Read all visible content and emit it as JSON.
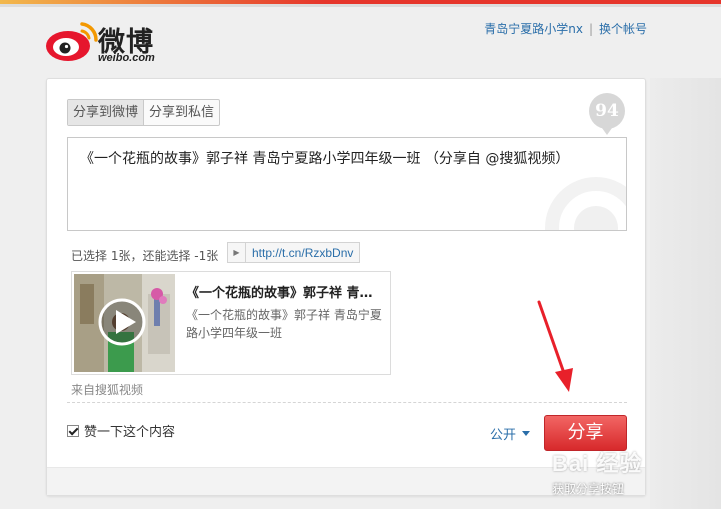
{
  "header": {
    "logo_cn": "微博",
    "logo_en": "weibo.com",
    "account_name": "青岛宁夏路小学nx",
    "switch_account": "换个帐号"
  },
  "compose": {
    "tabs": [
      {
        "label": "分享到微博",
        "active": true
      },
      {
        "label": "分享到私信",
        "active": false
      }
    ],
    "remaining_chars": "94",
    "text": "《一个花瓶的故事》郭子祥 青岛宁夏路小学四年级一班 （分享自 @搜狐视频）",
    "selection_info": "已选择 1张，还能选择 -1张",
    "short_link": "http://t.cn/RzxbDnv"
  },
  "card": {
    "title": "《一个花瓶的故事》郭子祥 青岛宁夏路小学四年级一班",
    "description": "《一个花瓶的故事》郭子祥 青岛宁夏路小学四年级一班",
    "source": "来自搜狐视频"
  },
  "footer": {
    "like_label": "赞一下这个内容",
    "like_checked": true,
    "visibility": "公开",
    "share_button": "分享"
  },
  "watermark": {
    "brand": "Bai 经验",
    "caption": "获取分享按钮"
  },
  "colors": {
    "link": "#2a6ea9",
    "share_button": "#e0393b",
    "annotation_arrow": "#e8202a"
  }
}
